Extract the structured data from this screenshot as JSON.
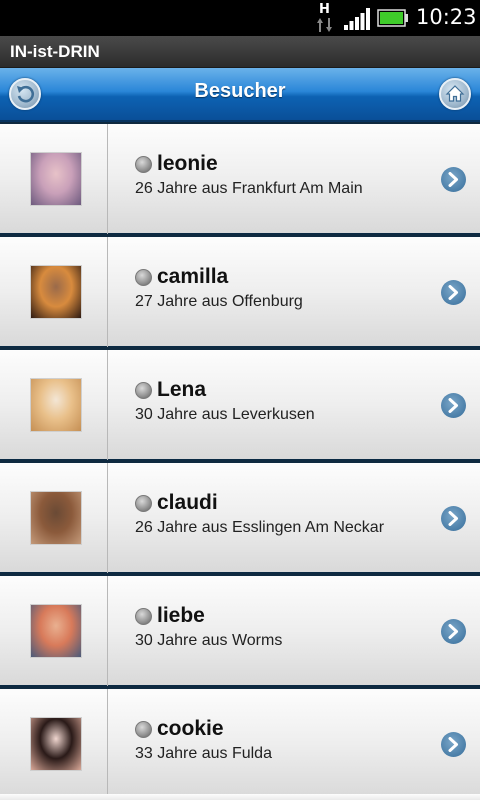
{
  "status_bar": {
    "network": "H",
    "time": "10:23"
  },
  "app": {
    "title": "IN-ist-DRIN"
  },
  "header": {
    "title": "Besucher"
  },
  "visitors": [
    {
      "name": "leonie",
      "info": "26 Jahre aus Frankfurt Am Main",
      "avatar_colors": [
        "#c9a0b9",
        "#6d5a7e",
        "#e7c2c8"
      ]
    },
    {
      "name": "camilla",
      "info": "27 Jahre aus Offenburg",
      "avatar_colors": [
        "#d88b3e",
        "#2d1a12",
        "#9a6a4a"
      ]
    },
    {
      "name": "Lena",
      "info": "30 Jahre aus Leverkusen",
      "avatar_colors": [
        "#e9c08a",
        "#c58f54",
        "#f3e6d5"
      ]
    },
    {
      "name": "claudi",
      "info": "26 Jahre aus Esslingen Am Neckar",
      "avatar_colors": [
        "#8b5a3b",
        "#c49a7a",
        "#6a4a35"
      ]
    },
    {
      "name": "liebe",
      "info": "30 Jahre aus Worms",
      "avatar_colors": [
        "#d87a5a",
        "#4a5a7a",
        "#e9b090"
      ]
    },
    {
      "name": "cookie",
      "info": "33 Jahre aus Fulda",
      "avatar_colors": [
        "#2a1a18",
        "#d9a898",
        "#f0d6cf"
      ]
    }
  ]
}
